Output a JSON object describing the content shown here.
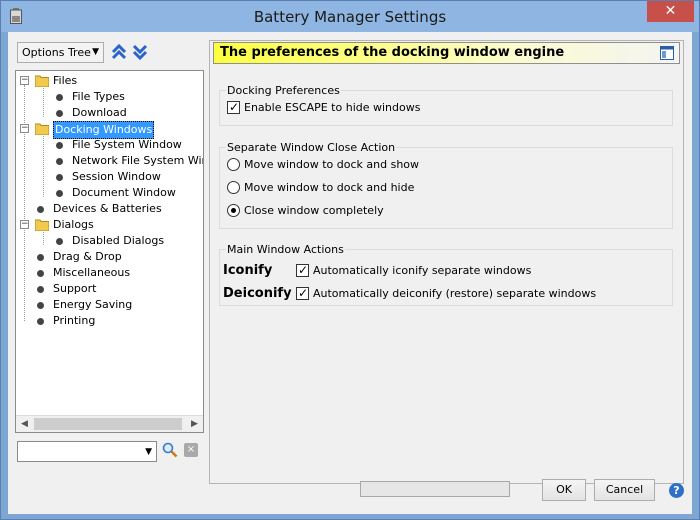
{
  "window": {
    "title": "Battery Manager Settings",
    "close_label": "✕"
  },
  "left": {
    "combo_value": "Options Tree",
    "tree": [
      {
        "label": "Files",
        "level": 0,
        "folder": true
      },
      {
        "label": "File Types",
        "level": 1
      },
      {
        "label": "Download",
        "level": 1
      },
      {
        "label": "Docking Windows",
        "level": 0,
        "folder": true,
        "selected": true
      },
      {
        "label": "File System Window",
        "level": 1
      },
      {
        "label": "Network File System Window",
        "level": 1
      },
      {
        "label": "Session Window",
        "level": 1
      },
      {
        "label": "Document Window",
        "level": 1
      },
      {
        "label": "Devices & Batteries",
        "level": 0
      },
      {
        "label": "Dialogs",
        "level": 0,
        "folder": true
      },
      {
        "label": "Disabled Dialogs",
        "level": 1
      },
      {
        "label": "Drag & Drop",
        "level": 0
      },
      {
        "label": "Miscellaneous",
        "level": 0
      },
      {
        "label": "Support",
        "level": 0
      },
      {
        "label": "Energy Saving",
        "level": 0
      },
      {
        "label": "Printing",
        "level": 0
      }
    ],
    "search_value": ""
  },
  "right": {
    "header_title": "The preferences of the docking window engine",
    "docking_group": {
      "title": "Docking Preferences",
      "option": "Enable ESCAPE to hide windows",
      "checked": true
    },
    "close_group": {
      "title": "Separate Window Close Action",
      "options": [
        "Move window to dock and show",
        "Move window to dock and hide",
        "Close window completely"
      ],
      "selected": 2
    },
    "main_group": {
      "title": "Main Window Actions",
      "iconify_label": "Iconify",
      "iconify_option": "Automatically iconify separate windows",
      "deiconify_label": "Deiconify",
      "deiconify_option": "Automatically deiconify (restore) separate windows"
    }
  },
  "footer": {
    "ok_label": "OK",
    "cancel_label": "Cancel",
    "help_label": "?",
    "progress": 0
  }
}
